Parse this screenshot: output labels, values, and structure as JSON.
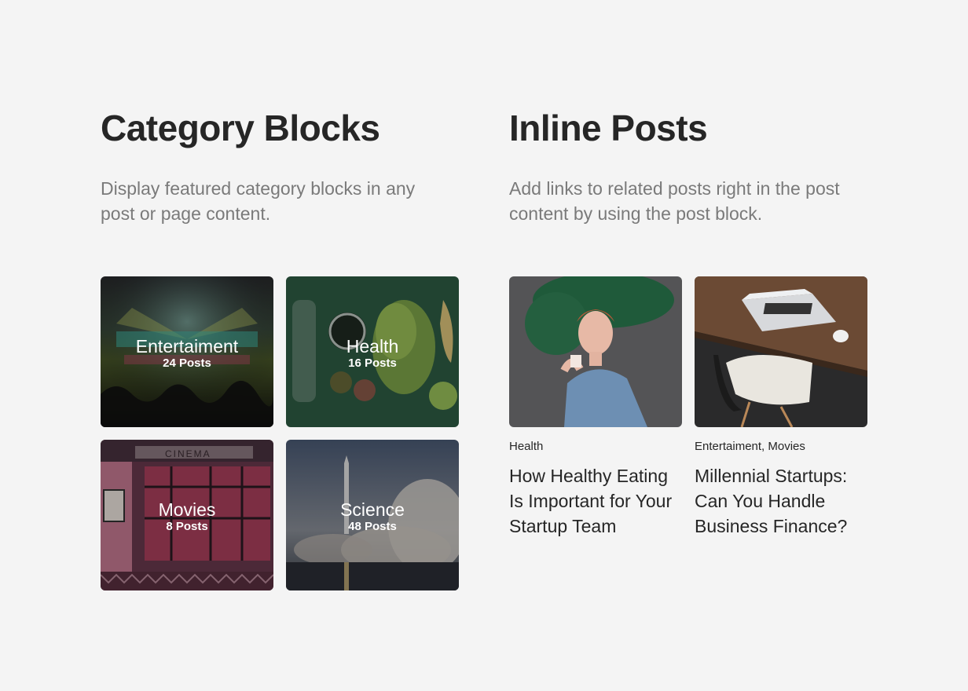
{
  "category_blocks": {
    "title": "Category Blocks",
    "description": "Display featured category blocks in any post or page content.",
    "items": [
      {
        "name": "Entertaiment",
        "count": "24 Posts",
        "image": "concert-photo"
      },
      {
        "name": "Health",
        "count": "16 Posts",
        "image": "healthy-food-photo"
      },
      {
        "name": "Movies",
        "count": "8 Posts",
        "image": "cinema-photo"
      },
      {
        "name": "Science",
        "count": "48 Posts",
        "image": "rocket-launch-photo"
      }
    ]
  },
  "inline_posts": {
    "title": "Inline Posts",
    "description": "Add links to related posts right in the post content by using the post block.",
    "items": [
      {
        "categories": "Health",
        "title": "How Healthy Eating Is Important for Your Startup Team",
        "image": "woman-portrait-photo"
      },
      {
        "categories": "Entertaiment, Movies",
        "title": "Millennial Startups: Can You Handle Business Finance?",
        "image": "laptop-desk-photo"
      }
    ]
  },
  "colors": {
    "background": "#f4f4f4",
    "heading": "#262626",
    "muted": "#7a7a7a"
  }
}
